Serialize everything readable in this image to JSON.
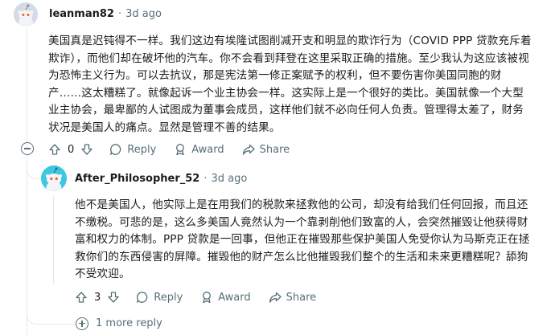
{
  "comment1": {
    "username": "leanman82",
    "separator": "·",
    "time": "3d ago",
    "body": "美国真是迟钝得不一样。我们这边有埃隆试图削减开支和明显的欺诈行为（COVID PPP 贷款充斥着欺诈），而他们却在破坏他的汽车。你不会看到拜登在这里采取正确的措施。至少我认为这应该被视为恐怖主义行为。可以去抗议，那是宪法第一修正案赋予的权利，但不要伤害你美国同胞的财产……这太糟糕了。就像起诉一个业主协会一样。这实际上是一个很好的类比。美国就像一个大型业主协会，最卑鄙的人试图成为董事会成员，这样他们就不必向任何人负责。管理得太差了，财务状况是美国人的痛点。显然是管理不善的结果。",
    "vote_count": "0",
    "reply_label": "Reply",
    "award_label": "Award",
    "share_label": "Share"
  },
  "comment2": {
    "username": "After_Philosopher_52",
    "separator": "·",
    "time": "3d ago",
    "body": "他不是美国人，他实际上是在用我们的税款来拯救他的公司，却没有给我们任何回报，而且还不缴税。可悲的是，这么多美国人竟然认为一个靠剥削他们致富的人，会突然摧毁让他获得财富和权力的体制。PPP 贷款是一回事，但他正在摧毁那些保护美国人免受你认为马斯克正在拯救你们的东西侵害的屏障。摧毁他的财产怎么比他摧毁我们整个的生活和未来更糟糕呢？舔狗不受欢迎。",
    "vote_count": "3",
    "reply_label": "Reply",
    "award_label": "Award",
    "share_label": "Share"
  },
  "more_replies_label": "1 more reply",
  "colors": {
    "avatar1_bg": "#d8dde8",
    "avatar2_bg": "#3ec7e0",
    "muted": "#576f76",
    "thread_line": "#e5e7e9"
  }
}
